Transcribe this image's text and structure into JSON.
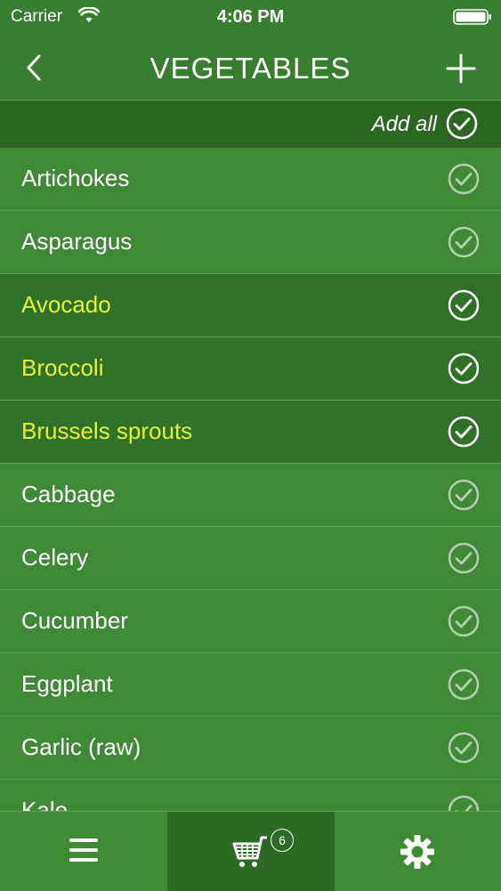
{
  "status": {
    "carrier": "Carrier",
    "time": "4:06 PM"
  },
  "nav": {
    "title": "VEGETABLES"
  },
  "add_all": {
    "label": "Add all"
  },
  "items": [
    {
      "label": "Artichokes",
      "selected": false
    },
    {
      "label": "Asparagus",
      "selected": false
    },
    {
      "label": "Avocado",
      "selected": true
    },
    {
      "label": "Broccoli",
      "selected": true
    },
    {
      "label": "Brussels sprouts",
      "selected": true
    },
    {
      "label": "Cabbage",
      "selected": false
    },
    {
      "label": "Celery",
      "selected": false
    },
    {
      "label": "Cucumber",
      "selected": false
    },
    {
      "label": "Eggplant",
      "selected": false
    },
    {
      "label": "Garlic (raw)",
      "selected": false
    },
    {
      "label": "Kale",
      "selected": false
    }
  ],
  "tabbar": {
    "cart_count": "6",
    "active_tab": "cart"
  },
  "colors": {
    "background": "#3f8a35",
    "header": "#377f2e",
    "add_all_bar": "#2b6623",
    "selected_row": "#2f7127",
    "selected_text": "#e8f13a"
  },
  "icons": {
    "back": "chevron-left-icon",
    "add": "plus-icon",
    "check": "check-circle-icon",
    "list": "menu-icon",
    "cart": "cart-icon",
    "settings": "gear-icon"
  }
}
